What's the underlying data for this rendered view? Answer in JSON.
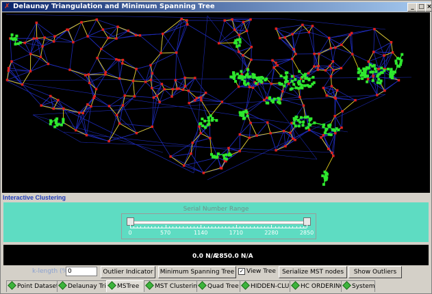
{
  "window": {
    "title": "Delaunay Triangulation and Minimum Spanning Tree",
    "controls": {
      "minimize": "_",
      "maximize": "□",
      "close": "×"
    }
  },
  "colors": {
    "canvas_bg": "#000000",
    "tri_edge": "#1e2bb8",
    "tree_edge": "#e8d21c",
    "node": "#e0201c",
    "cluster_node": "#2ee82e",
    "range_panel": "#5edcc2",
    "section_title": "#1f3ab8"
  },
  "section_title": "Interactive Clustering",
  "range": {
    "title": "Serial Number Range",
    "ticks": [
      "0",
      "570",
      "1140",
      "1710",
      "2280",
      "2850"
    ],
    "lower": 0,
    "upper": 2850,
    "max": 2850
  },
  "status": {
    "left": "0.0 N/A",
    "right": "2850.0 N/A"
  },
  "controls": {
    "k_length_label": "k-length (%):",
    "k_length_value": "0",
    "outlier_indicator": "Outlier Indicator",
    "minimum_spanning_tree": "Minimum Spanning Tree",
    "view_tree_label": "View Tree",
    "view_tree_checked": true,
    "serialize": "Serialize MST nodes",
    "show_outliers": "Show Outliers"
  },
  "tabs": [
    {
      "label": "Point Dataset",
      "active": false
    },
    {
      "label": "Delaunay Tri.",
      "active": false
    },
    {
      "label": "MSTree",
      "active": true
    },
    {
      "label": "MST Clustering",
      "active": false
    },
    {
      "label": "Quad Tree",
      "active": false
    },
    {
      "label": "HIDDEN-CLUE",
      "active": false
    },
    {
      "label": "HC ORDERING",
      "active": false
    },
    {
      "label": "System",
      "active": false
    }
  ]
}
